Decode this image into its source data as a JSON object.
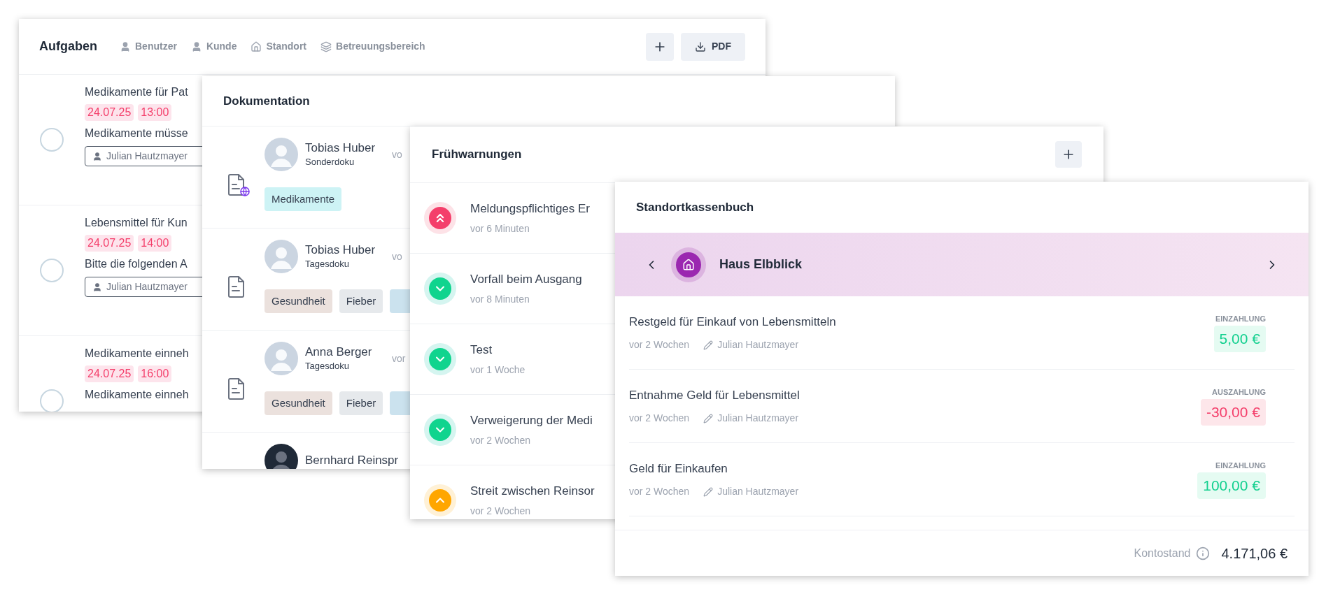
{
  "tasks_panel": {
    "title": "Aufgaben",
    "filters": [
      {
        "kind": "user",
        "label": "Benutzer"
      },
      {
        "kind": "user",
        "label": "Kunde"
      },
      {
        "kind": "location",
        "label": "Standort"
      },
      {
        "kind": "area",
        "label": "Betreuungsbereich"
      }
    ],
    "pdf_button": "PDF",
    "tasks": [
      {
        "title": "Medikamente für Pat",
        "date": "24.07.25",
        "time": "13:00",
        "description": "Medikamente müsse",
        "assignee": "Julian Hautzmayer",
        "checked": false
      },
      {
        "title": "Lebensmittel für Kun",
        "date": "24.07.25",
        "time": "14:00",
        "description": "Bitte die folgenden A",
        "assignee": "Julian Hautzmayer",
        "checked": false
      },
      {
        "title": "Medikamente einneh",
        "date": "24.07.25",
        "time": "16:00",
        "description": "Medikamente einneh",
        "checked": false
      }
    ]
  },
  "documentation_panel": {
    "title": "Dokumentation",
    "entries": [
      {
        "kind": "special",
        "name": "Tobias Huber",
        "type": "Sonderdoku",
        "time": "vo",
        "tags": [
          {
            "label": "Medikamente",
            "color": "#cdf3f5"
          }
        ]
      },
      {
        "kind": "daily",
        "name": "Tobias Huber",
        "type": "Tagesdoku",
        "time": "vo",
        "tags": [
          {
            "label": "Gesundheit",
            "color": "#ebe1dd"
          },
          {
            "label": "Fieber",
            "color": "#e6e9ec"
          },
          {
            "color": "#cbe2ee"
          }
        ]
      },
      {
        "kind": "daily",
        "name": "Anna Berger",
        "type": "Tagesdoku",
        "time": "vor",
        "tags": [
          {
            "label": "Gesundheit",
            "color": "#ebe1dd"
          },
          {
            "label": "Fieber",
            "color": "#e6e9ec"
          },
          {
            "color": "#cbe2ee"
          }
        ]
      },
      {
        "name": "Bernhard Reinspr"
      }
    ]
  },
  "warnings_panel": {
    "title": "Frühwarnungen",
    "entries": [
      {
        "kind": "critical",
        "title": "Meldungspflichtiges Er",
        "time": "vor 6 Minuten"
      },
      {
        "kind": "low",
        "title": "Vorfall beim Ausgang",
        "time": "vor 8 Minuten"
      },
      {
        "kind": "low",
        "title": "Test",
        "time": "vor 1 Woche"
      },
      {
        "kind": "low",
        "title": "Verweigerung der Medi",
        "time": "vor 2 Wochen"
      },
      {
        "kind": "medium",
        "title": "Streit zwischen Reinsor",
        "time": "vor 2 Wochen"
      }
    ]
  },
  "cashbook_panel": {
    "title": "Standortkassenbuch",
    "location": "Haus Elbblick",
    "entries": [
      {
        "kind": "deposit",
        "type_label": "EINZAHLUNG",
        "title": "Restgeld für Einkauf von Lebensmitteln",
        "time": "vor 2 Wochen",
        "author": "Julian Hautzmayer",
        "amount": "5,00 €"
      },
      {
        "kind": "withdrawal",
        "type_label": "AUSZAHLUNG",
        "title": "Entnahme Geld für Lebensmittel",
        "time": "vor 2 Wochen",
        "author": "Julian Hautzmayer",
        "amount": "-30,00 €"
      },
      {
        "kind": "deposit",
        "type_label": "EINZAHLUNG",
        "title": "Geld für Einkaufen",
        "time": "vor 2 Wochen",
        "author": "Julian Hautzmayer",
        "amount": "100,00 €"
      }
    ],
    "balance_label": "Kontostand",
    "balance": "4.171,06 €"
  }
}
